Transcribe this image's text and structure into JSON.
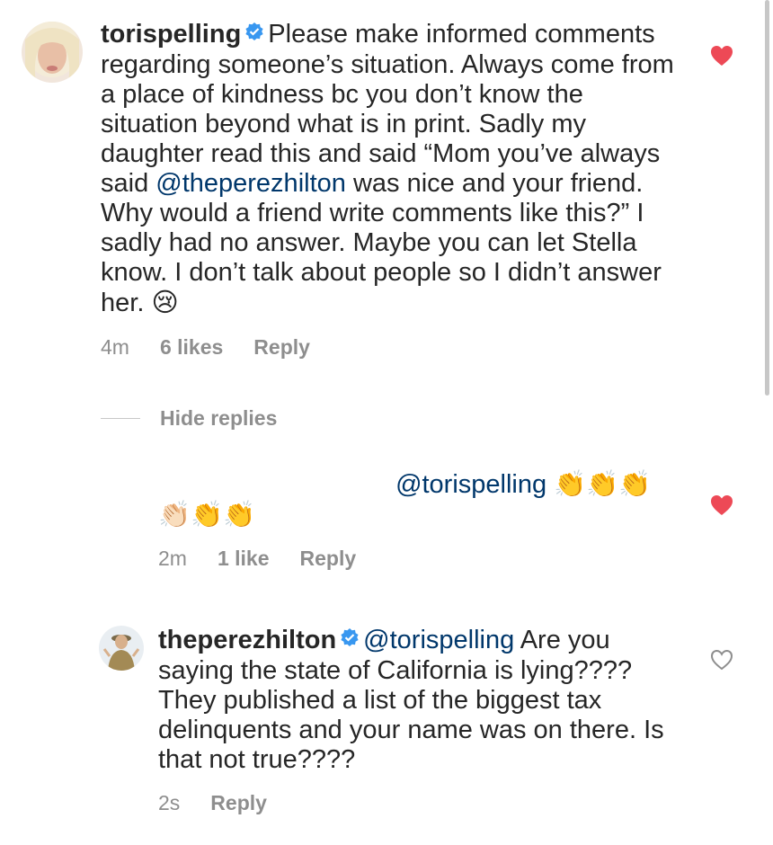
{
  "comments": [
    {
      "username": "torispelling",
      "verified": true,
      "text_before": "Please make informed comments regarding someone’s situation. Always come from a place of kindness bc you don’t know the situation beyond what is in print. Sadly my daughter read this and said “Mom you’ve always said ",
      "mention": "@theperezhilton",
      "text_after": " was nice and your friend. Why would a friend write comments like this?” I sadly had no answer. Maybe you can let Stella know. I don’t talk about people so I didn’t answer her. ",
      "emoji": "😢",
      "time": "4m",
      "likes": "6 likes",
      "reply": "Reply",
      "liked": true
    }
  ],
  "hide_replies": "Hide replies",
  "replies": [
    {
      "username": "",
      "mention": "@torispelling",
      "emoji_line1": "👏👏👏",
      "emoji_line2": "👏🏻👏👏",
      "time": "2m",
      "likes": "1 like",
      "reply": "Reply",
      "liked": true
    },
    {
      "username": "theperezhilton",
      "verified": true,
      "mention": "@torispelling",
      "text": " Are you saying the state of California is lying???? They published a list of the biggest tax delinquents and your name was on there. Is that not true????",
      "time": "2s",
      "reply": "Reply",
      "liked": false
    }
  ],
  "colors": {
    "text": "#262626",
    "mention": "#00376b",
    "meta": "#8e8e8e",
    "heart_red": "#ed4956",
    "verified_blue": "#3897f0"
  }
}
